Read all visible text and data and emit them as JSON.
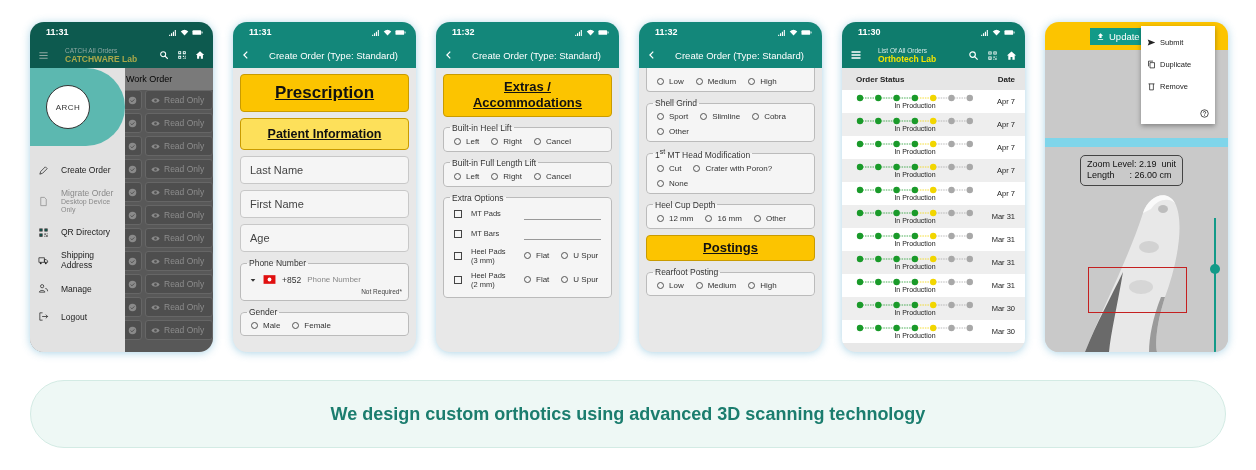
{
  "phones": [
    {
      "kind": "drawer",
      "time": "11:31",
      "header": {
        "title": "CATCH All Orders",
        "subtitle": "CATCHWARE Lab"
      },
      "column": "Work Order",
      "rows": [
        {
          "action": "Read Only"
        },
        {
          "action": "Read Only"
        },
        {
          "action": "Read Only"
        },
        {
          "action": "Read Only"
        },
        {
          "action": "Read Only"
        },
        {
          "action": "Read Only"
        },
        {
          "action": "Read Only"
        },
        {
          "action": "Read Only"
        },
        {
          "action": "Read Only"
        },
        {
          "action": "Read Only"
        },
        {
          "action": "Read Only"
        }
      ],
      "drawer": {
        "logo": "ARCH",
        "items": [
          {
            "label": "Create Order",
            "disabled": false
          },
          {
            "label": "Migrate Order",
            "disabled": true,
            "note": "Desktop Device Only"
          },
          {
            "label": "QR Directory",
            "disabled": false
          },
          {
            "label": "Shipping Address",
            "disabled": false
          },
          {
            "label": "Manage",
            "disabled": false
          },
          {
            "label": "Logout",
            "disabled": false
          }
        ]
      }
    },
    {
      "kind": "form",
      "time": "11:31",
      "title": "Create Order (Type: Standard)",
      "blocks": [
        {
          "kind": "title",
          "text": "Prescription"
        },
        {
          "kind": "subtitle",
          "text": "Patient Information"
        },
        {
          "kind": "field",
          "placeholder": "Last Name"
        },
        {
          "kind": "field",
          "placeholder": "First Name"
        },
        {
          "kind": "field",
          "placeholder": "Age"
        },
        {
          "kind": "phone",
          "label": "Phone Number",
          "code": "+852",
          "placeholder": "Phone Number",
          "note": "Not Required*"
        },
        {
          "kind": "radios",
          "label": "Gender",
          "options": [
            {
              "label": "Male",
              "selected": false
            },
            {
              "label": "Female",
              "selected": false
            }
          ]
        }
      ]
    },
    {
      "kind": "form",
      "time": "11:32",
      "title": "Create Order (Type: Standard)",
      "blocks": [
        {
          "kind": "banner",
          "text": "Extras / Accommodations"
        },
        {
          "kind": "radios",
          "label": "Built-in Heel Lift",
          "options": [
            {
              "label": "Left",
              "selected": false
            },
            {
              "label": "Right",
              "selected": false
            },
            {
              "label": "Cancel",
              "selected": false
            }
          ]
        },
        {
          "kind": "radios",
          "label": "Built-in Full Length Lift",
          "options": [
            {
              "label": "Left",
              "selected": false
            },
            {
              "label": "Right",
              "selected": false
            },
            {
              "label": "Cancel",
              "selected": false
            }
          ]
        },
        {
          "kind": "checks",
          "label": "Extra Options",
          "items": [
            {
              "label": "MT Pads",
              "checked": false
            },
            {
              "label": "MT Bars",
              "checked": false
            },
            {
              "label": "Heel Pads (3 mm)",
              "checked": false,
              "options": [
                {
                  "label": "Flat",
                  "selected": false
                },
                {
                  "label": "U Spur",
                  "selected": false
                }
              ]
            },
            {
              "label": "Heel Pads (2 mm)",
              "checked": false,
              "options": [
                {
                  "label": "Flat",
                  "selected": false
                },
                {
                  "label": "U Spur",
                  "selected": false
                }
              ]
            }
          ]
        }
      ]
    },
    {
      "kind": "form",
      "time": "11:32",
      "title": "Create Order (Type: Standard)",
      "blocks": [
        {
          "kind": "radios",
          "options": [
            {
              "label": "Low",
              "selected": false
            },
            {
              "label": "Medium",
              "selected": false
            },
            {
              "label": "High",
              "selected": false
            }
          ]
        },
        {
          "kind": "radios",
          "label": "Shell Grind",
          "options": [
            {
              "label": "Sport",
              "selected": false
            },
            {
              "label": "Slimline",
              "selected": false
            },
            {
              "label": "Cobra",
              "selected": false
            },
            {
              "label": "Other",
              "selected": false
            }
          ]
        },
        {
          "kind": "radios",
          "label": "1$^{st}$ MT Head Modification",
          "options": [
            {
              "label": "Cut",
              "selected": false
            },
            {
              "label": "Crater with Poron?",
              "selected": false
            },
            {
              "label": "None",
              "selected": false
            }
          ]
        },
        {
          "kind": "radios",
          "label": "Heel Cup Depth",
          "options": [
            {
              "label": "12 mm",
              "selected": false
            },
            {
              "label": "16 mm",
              "selected": false
            },
            {
              "label": "Other",
              "selected": false
            }
          ]
        },
        {
          "kind": "banner",
          "text": "Postings"
        },
        {
          "kind": "radios",
          "label": "Rearfoot Posting",
          "options": [
            {
              "label": "Low",
              "selected": false
            },
            {
              "label": "Medium",
              "selected": false
            },
            {
              "label": "High",
              "selected": false
            }
          ]
        }
      ]
    },
    {
      "kind": "orders",
      "time": "11:30",
      "header": {
        "title": "List Of All Orders",
        "subtitle": "Orthotech Lab"
      },
      "columns": [
        "Order Status",
        "Date"
      ],
      "rows": [
        {
          "steps": [
            {
              "color": "#1a9a2a"
            },
            {
              "color": "#1a9a2a"
            },
            {
              "color": "#1a9a2a"
            },
            {
              "color": "#1a9a2a"
            },
            {
              "color": "#f2d600"
            },
            {
              "color": "#a8a8a8"
            },
            {
              "color": "#a8a8a8"
            }
          ],
          "status": "In Production",
          "date": "Apr 7"
        },
        {
          "steps": [
            {
              "color": "#1a9a2a"
            },
            {
              "color": "#1a9a2a"
            },
            {
              "color": "#1a9a2a"
            },
            {
              "color": "#1a9a2a"
            },
            {
              "color": "#f2d600"
            },
            {
              "color": "#a8a8a8"
            },
            {
              "color": "#a8a8a8"
            }
          ],
          "status": "In Production",
          "date": "Apr 7"
        },
        {
          "steps": [
            {
              "color": "#1a9a2a"
            },
            {
              "color": "#1a9a2a"
            },
            {
              "color": "#1a9a2a"
            },
            {
              "color": "#1a9a2a"
            },
            {
              "color": "#f2d600"
            },
            {
              "color": "#a8a8a8"
            },
            {
              "color": "#a8a8a8"
            }
          ],
          "status": "In Production",
          "date": "Apr 7"
        },
        {
          "steps": [
            {
              "color": "#1a9a2a"
            },
            {
              "color": "#1a9a2a"
            },
            {
              "color": "#1a9a2a"
            },
            {
              "color": "#1a9a2a"
            },
            {
              "color": "#f2d600"
            },
            {
              "color": "#a8a8a8"
            },
            {
              "color": "#a8a8a8"
            }
          ],
          "status": "In Production",
          "date": "Apr 7"
        },
        {
          "steps": [
            {
              "color": "#1a9a2a"
            },
            {
              "color": "#1a9a2a"
            },
            {
              "color": "#1a9a2a"
            },
            {
              "color": "#1a9a2a"
            },
            {
              "color": "#f2d600"
            },
            {
              "color": "#a8a8a8"
            },
            {
              "color": "#a8a8a8"
            }
          ],
          "status": "In Production",
          "date": "Apr 7"
        },
        {
          "steps": [
            {
              "color": "#1a9a2a"
            },
            {
              "color": "#1a9a2a"
            },
            {
              "color": "#1a9a2a"
            },
            {
              "color": "#1a9a2a"
            },
            {
              "color": "#f2d600"
            },
            {
              "color": "#a8a8a8"
            },
            {
              "color": "#a8a8a8"
            }
          ],
          "status": "In Production",
          "date": "Mar 31"
        },
        {
          "steps": [
            {
              "color": "#1a9a2a"
            },
            {
              "color": "#1a9a2a"
            },
            {
              "color": "#1a9a2a"
            },
            {
              "color": "#1a9a2a"
            },
            {
              "color": "#f2d600"
            },
            {
              "color": "#a8a8a8"
            },
            {
              "color": "#a8a8a8"
            }
          ],
          "status": "In Production",
          "date": "Mar 31"
        },
        {
          "steps": [
            {
              "color": "#1a9a2a"
            },
            {
              "color": "#1a9a2a"
            },
            {
              "color": "#1a9a2a"
            },
            {
              "color": "#1a9a2a"
            },
            {
              "color": "#f2d600"
            },
            {
              "color": "#a8a8a8"
            },
            {
              "color": "#a8a8a8"
            }
          ],
          "status": "In Production",
          "date": "Mar 31"
        },
        {
          "steps": [
            {
              "color": "#1a9a2a"
            },
            {
              "color": "#1a9a2a"
            },
            {
              "color": "#1a9a2a"
            },
            {
              "color": "#1a9a2a"
            },
            {
              "color": "#f2d600"
            },
            {
              "color": "#a8a8a8"
            },
            {
              "color": "#a8a8a8"
            }
          ],
          "status": "In Production",
          "date": "Mar 31"
        },
        {
          "steps": [
            {
              "color": "#1a9a2a"
            },
            {
              "color": "#1a9a2a"
            },
            {
              "color": "#1a9a2a"
            },
            {
              "color": "#1a9a2a"
            },
            {
              "color": "#f2d600"
            },
            {
              "color": "#a8a8a8"
            },
            {
              "color": "#a8a8a8"
            }
          ],
          "status": "In Production",
          "date": "Mar 30"
        },
        {
          "steps": [
            {
              "color": "#1a9a2a"
            },
            {
              "color": "#1a9a2a"
            },
            {
              "color": "#1a9a2a"
            },
            {
              "color": "#1a9a2a"
            },
            {
              "color": "#f2d600"
            },
            {
              "color": "#a8a8a8"
            },
            {
              "color": "#a8a8a8"
            }
          ],
          "status": "In Production",
          "date": "Mar 30"
        }
      ]
    },
    {
      "kind": "viewer",
      "button": "Update",
      "menu": [
        "Submit",
        "Duplicate",
        "Remove"
      ],
      "readout": [
        "Zoom Level: 2.19  unit",
        "Length      : 26.00 cm"
      ],
      "zoom_slider": {
        "level": 0.62
      }
    }
  ],
  "caption": "We design custom orthotics using advanced 3D scanning technology"
}
